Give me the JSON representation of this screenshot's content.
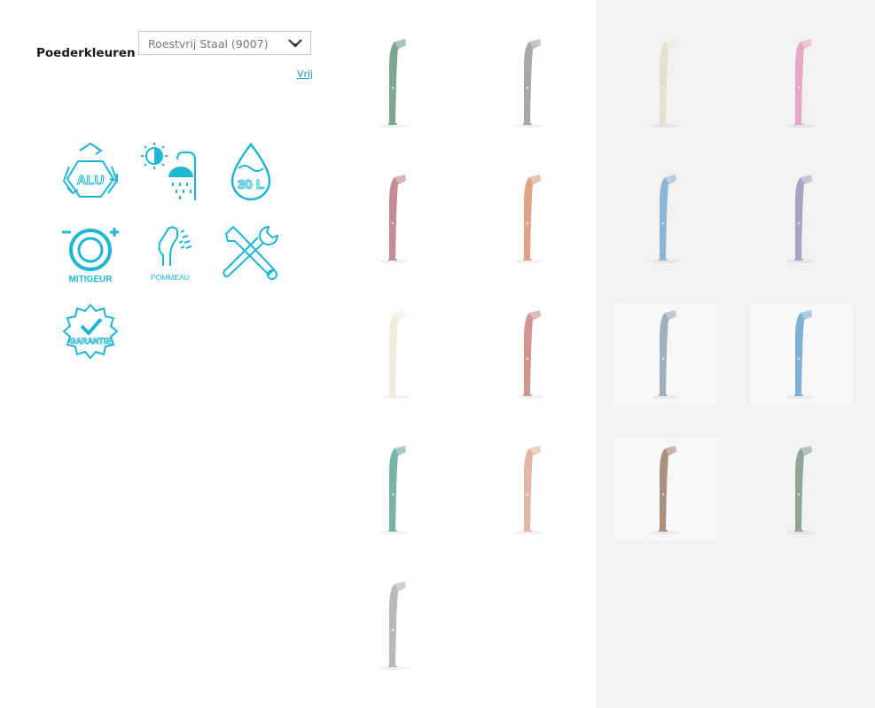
{
  "filter": {
    "label": "Poederkleuren",
    "selected": "Roestvrij Staal (9007)",
    "reset_label": "Vrij"
  },
  "features": [
    {
      "name": "alu-recycle-icon",
      "text": "ALU"
    },
    {
      "name": "solar-shower-icon",
      "text": ""
    },
    {
      "name": "water-drop-30l-icon",
      "text": "30 L"
    },
    {
      "name": "mixer-icon",
      "text": "MITIGEUR"
    },
    {
      "name": "shower-head-icon",
      "text": "POMMEAU"
    },
    {
      "name": "tools-icon",
      "text": ""
    },
    {
      "name": "guarantee-badge-icon",
      "text": "GARANTIE"
    }
  ],
  "colors": {
    "accent": "#1fb6d4",
    "swatches": [
      "#7fa693",
      "#a8a8a8",
      "#e6e0d2",
      "#e6a7c2",
      "#c88a95",
      "#e0a184",
      "#8fb4d1",
      "#a9a5c0",
      "#f1ebde",
      "#d39591",
      "#9eb0bd",
      "#7fb0d3",
      "#78b2a9",
      "#e3b5a6",
      "#ab9080",
      "#8fa595",
      "#b9b9b9"
    ]
  }
}
